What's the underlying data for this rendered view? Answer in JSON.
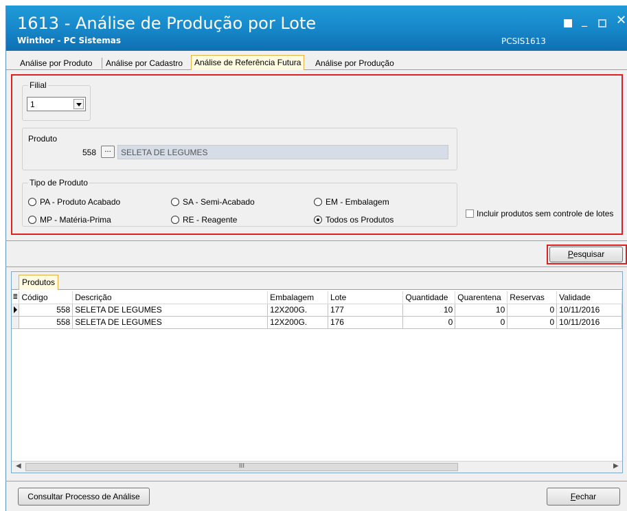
{
  "window": {
    "title": "1613 - Análise de Produção por Lote",
    "subtitle": "Winthor - PC Sistemas",
    "code": "PCSIS1613"
  },
  "tabs": [
    {
      "label": "Análise por Produto",
      "active": false
    },
    {
      "label": "Análise por Cadastro",
      "active": false
    },
    {
      "label": "Análise de Referência Futura",
      "active": true
    },
    {
      "label": "Análise por Produção",
      "active": false
    }
  ],
  "filters": {
    "filial_label": "Filial",
    "filial_value": "1",
    "produto_label": "Produto",
    "produto_code": "558",
    "produto_lookup": "...",
    "produto_desc": "SELETA DE LEGUMES",
    "tipo_label": "Tipo de Produto",
    "radios": [
      {
        "label": "PA - Produto Acabado",
        "checked": false
      },
      {
        "label": "SA - Semi-Acabado",
        "checked": false
      },
      {
        "label": "EM - Embalagem",
        "checked": false
      },
      {
        "label": "MP - Matéria-Prima",
        "checked": false
      },
      {
        "label": "RE - Reagente",
        "checked": false
      },
      {
        "label": "Todos os Produtos",
        "checked": true
      }
    ],
    "incluir_label": "Incluir produtos sem controle de lotes",
    "incluir_checked": false
  },
  "actions": {
    "pesquisar_first": "P",
    "pesquisar_rest": "esquisar",
    "consultar": "Consultar Processo de Análise",
    "fechar_first": "F",
    "fechar_rest": "echar"
  },
  "grid": {
    "tab_label": "Produtos",
    "columns": [
      "Código",
      "Descrição",
      "Embalagem",
      "Lote",
      "Quantidade",
      "Quarentena",
      "Reservas",
      "Validade"
    ],
    "rows": [
      {
        "codigo": "558",
        "descricao": "SELETA DE LEGUMES",
        "embalagem": "12X200G.",
        "lote": "177",
        "quantidade": "10",
        "quarentena": "10",
        "reservas": "0",
        "validade": "10/11/2016",
        "current": true
      },
      {
        "codigo": "558",
        "descricao": "SELETA DE LEGUMES",
        "embalagem": "12X200G.",
        "lote": "176",
        "quantidade": "0",
        "quarentena": "0",
        "reservas": "0",
        "validade": "10/11/2016",
        "current": false
      }
    ],
    "scroll_grip": "III"
  }
}
